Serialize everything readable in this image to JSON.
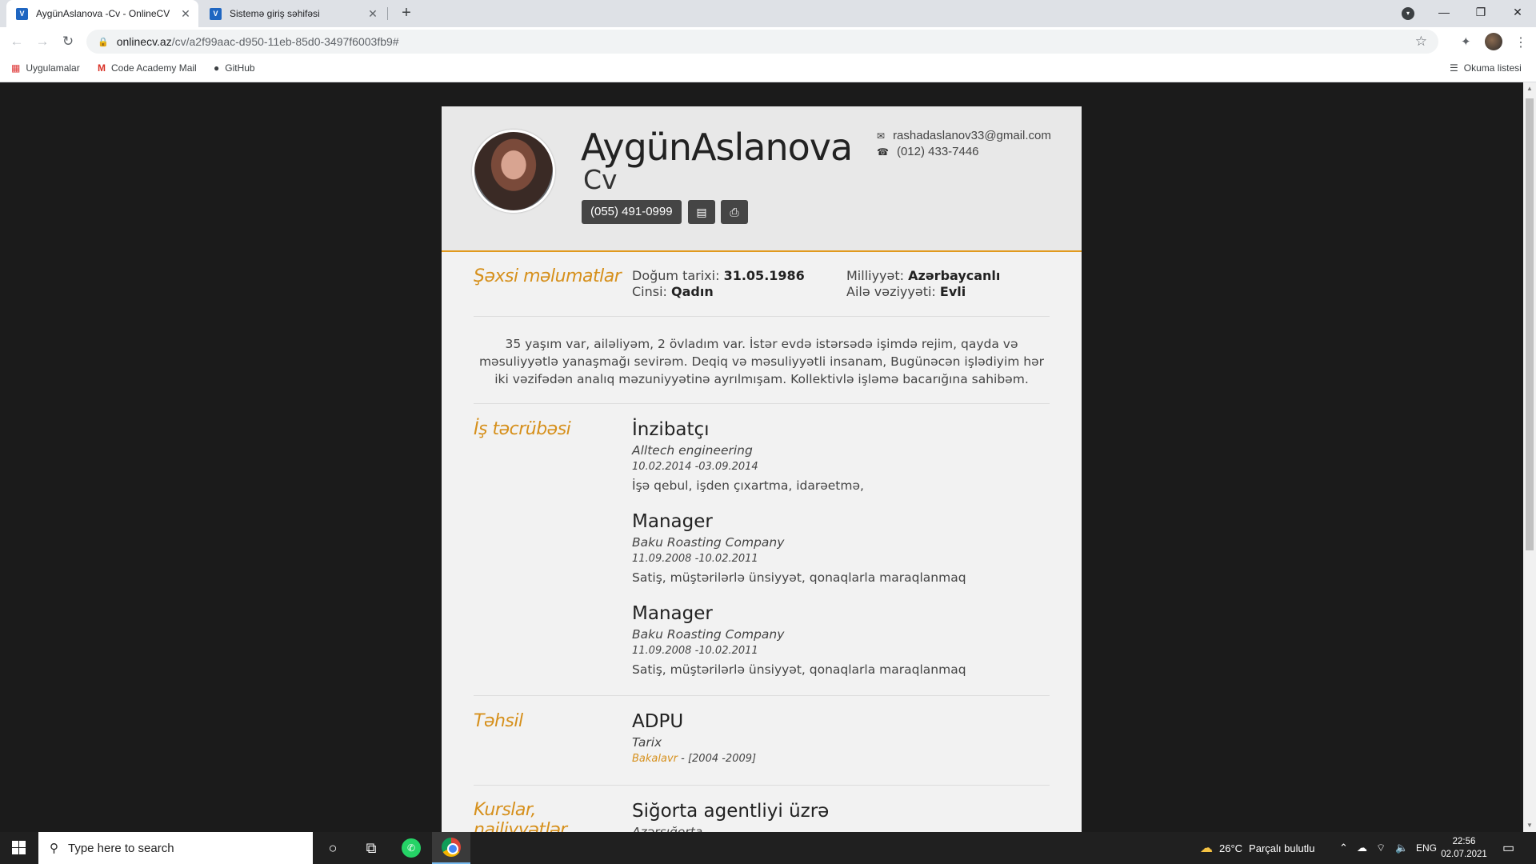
{
  "browser": {
    "tabs": [
      {
        "favicon": "V",
        "title": "AygünAslanova -Cv - OnlineCV",
        "active": true
      },
      {
        "favicon": "V",
        "title": "Sistemə giriş səhifəsi",
        "active": false
      }
    ],
    "url_host": "onlinecv.az",
    "url_path": "/cv/a2f99aac-d950-11eb-85d0-3497f6003fb9#",
    "bookmarks": [
      {
        "label": "Uygulamalar",
        "icon": "apps-grid-icon"
      },
      {
        "label": "Code Academy Mail",
        "icon": "gmail-icon"
      },
      {
        "label": "GitHub",
        "icon": "github-icon"
      }
    ],
    "reading_list": "Okuma listesi"
  },
  "cv": {
    "name": "AygünAslanova",
    "subtitle": "Cv",
    "phone_mobile": "(055) 491-0999",
    "email": "rashadaslanov33@gmail.com",
    "phone_home": "(012) 433-7446",
    "accent_color": "#d6901c",
    "personal": {
      "title": "Şəxsi məlumatlar",
      "birth_label": "Doğum tarixi:",
      "birth_value": "31.05.1986",
      "gender_label": "Cinsi:",
      "gender_value": "Qadın",
      "nationality_label": "Milliyyət:",
      "nationality_value": "Azərbaycanlı",
      "marital_label": "Ailə vəziyyəti:",
      "marital_value": "Evli"
    },
    "about": "35 yaşım var, ailəliyəm, 2 övladım var. İstər evdə istərsədə işimdə rejim, qayda və məsuliyyətlə yanaşmağı sevirəm. Deqiq və məsuliyyətli insanam, Bugünəcən işlədiyim hər iki vəzifədən analıq məzuniyyətinə ayrılmışam. Kollektivlə işləmə bacarığına sahibəm.",
    "experience": {
      "title": "İş təcrübəsi",
      "jobs": [
        {
          "position": "İnzibatçı",
          "company": "Alltech engineering",
          "dates": "10.02.2014 -03.09.2014",
          "description": "İşə qebul, işden çıxartma, idarəetmə,"
        },
        {
          "position": "Manager",
          "company": "Baku Roasting Company",
          "dates": "11.09.2008 -10.02.2011",
          "description": "Satiş, müştərilərlə ünsiyyət, qonaqlarla maraqlanmaq"
        },
        {
          "position": "Manager",
          "company": "Baku Roasting Company",
          "dates": "11.09.2008 -10.02.2011",
          "description": "Satiş, müştərilərlə ünsiyyət, qonaqlarla maraqlanmaq"
        }
      ]
    },
    "education": {
      "title": "Təhsil",
      "school": "ADPU",
      "field": "Tarix",
      "degree": "Bakalavr",
      "years": " - [2004 -2009]"
    },
    "courses": {
      "title": "Kurslar, nailiyyətlər",
      "name": "Siğorta agentliyi üzrə",
      "org": "Azərsığorta"
    }
  },
  "taskbar": {
    "search_placeholder": "Type here to search",
    "weather_temp": "26°C",
    "weather_text": "Parçalı bulutlu",
    "language": "ENG",
    "time": "22:56",
    "date": "02.07.2021"
  }
}
